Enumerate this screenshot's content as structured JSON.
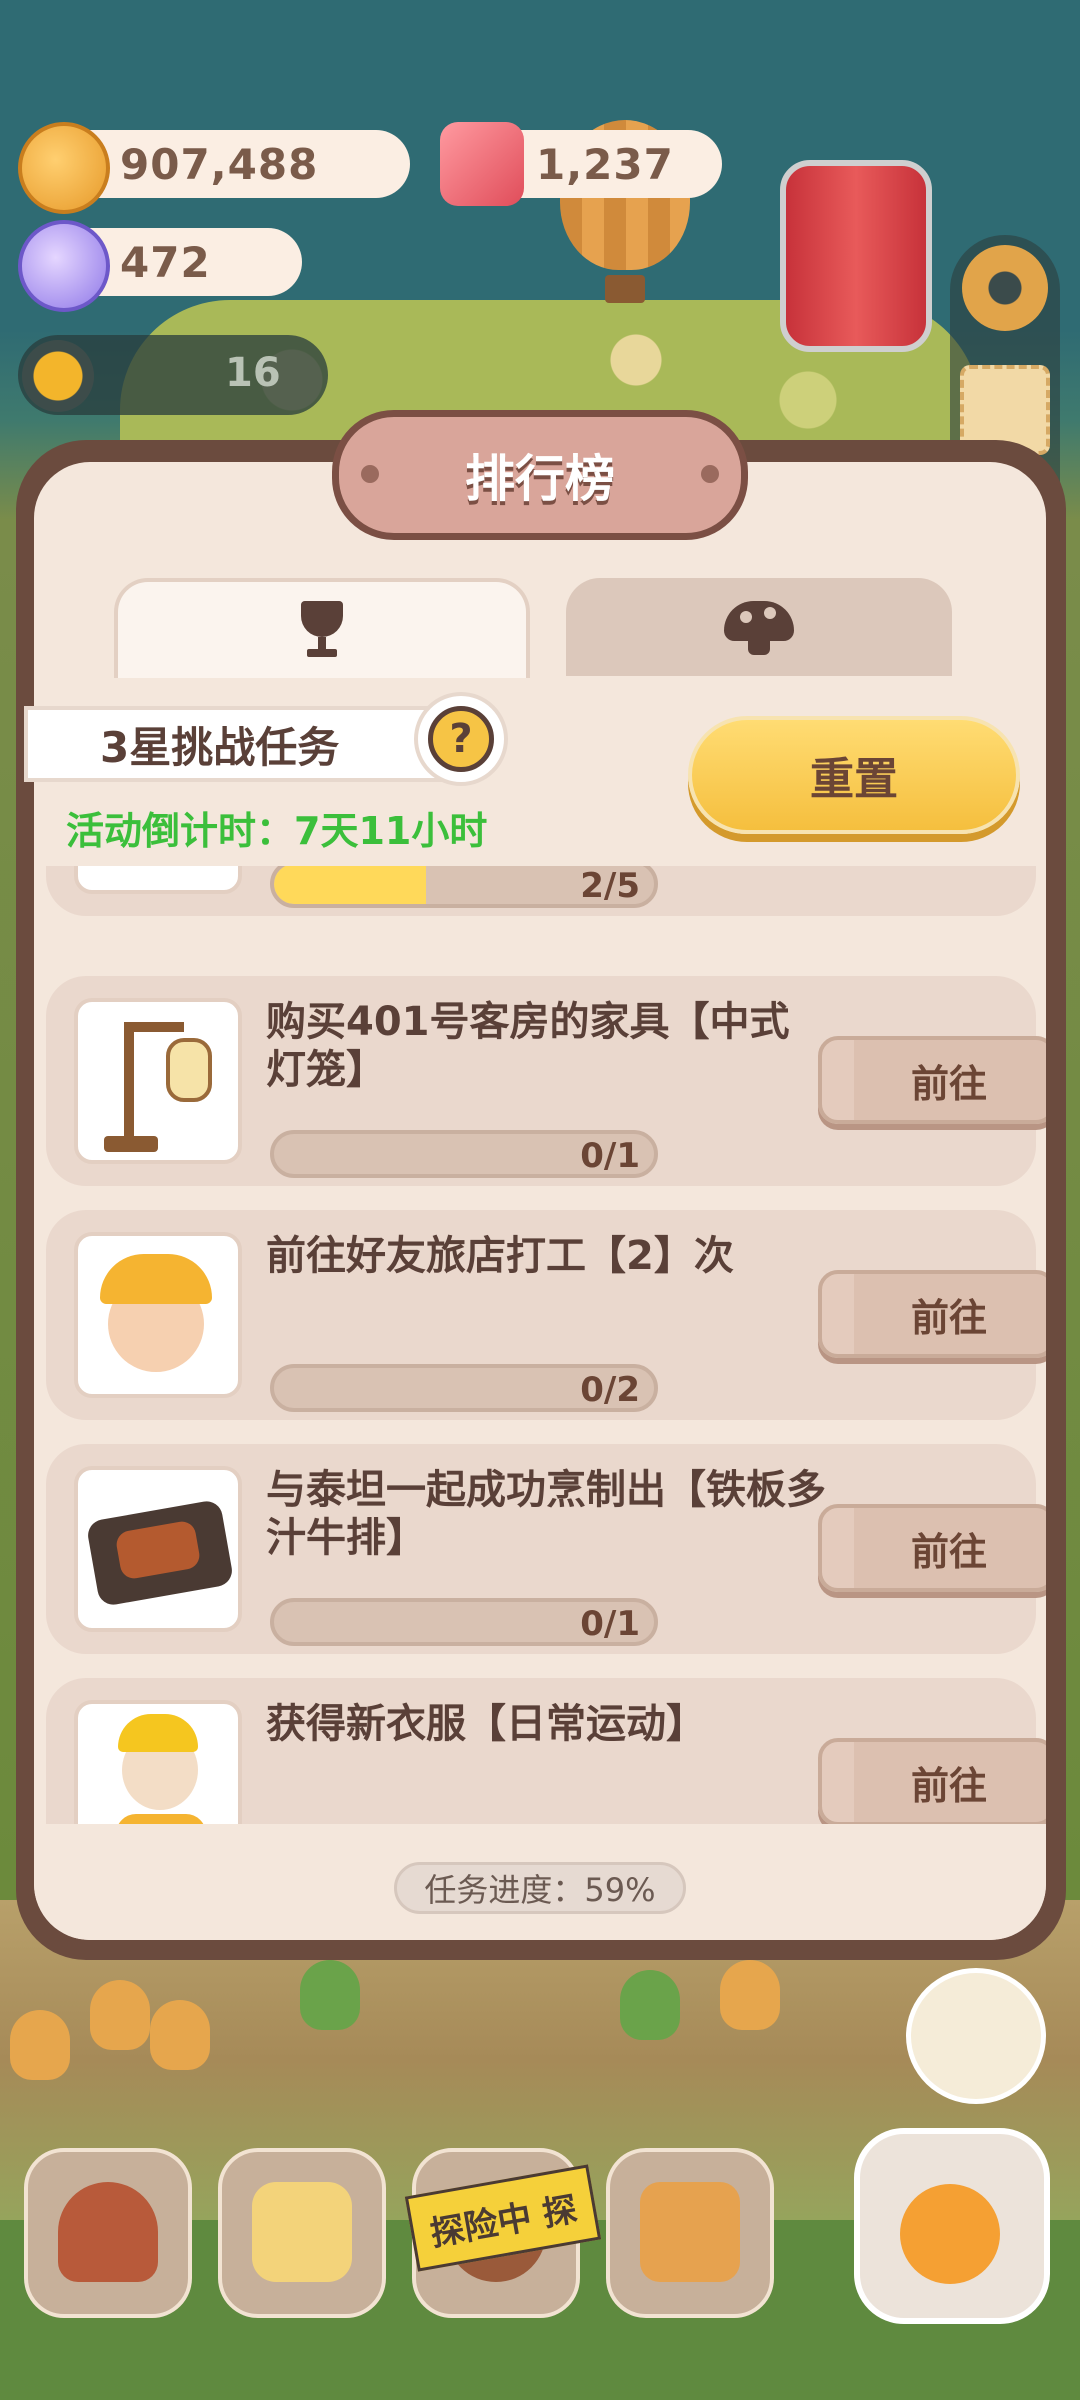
{
  "resources": {
    "cookies": "907,488",
    "gems": "1,237",
    "candy": "472"
  },
  "level": {
    "value": "16"
  },
  "panel": {
    "title": "排行榜",
    "tabs": [
      {
        "icon": "trophy-icon",
        "active": true
      },
      {
        "icon": "mushroom-icon",
        "active": false
      }
    ],
    "challenge_label": "3星挑战任务",
    "help_symbol": "?",
    "countdown": "活动倒计时：7天11小时",
    "reset_label": "重置",
    "tasks": [
      {
        "desc": "",
        "progress": "2/5",
        "fraction": 0.4,
        "go_label": ""
      },
      {
        "desc": "购买401号客房的家具【中式灯笼】",
        "progress": "0/1",
        "fraction": 0,
        "go_label": "前往"
      },
      {
        "desc": "前往好友旅店打工【2】次",
        "progress": "0/2",
        "fraction": 0,
        "go_label": "前往"
      },
      {
        "desc": "与泰坦一起成功烹制出【铁板多汁牛排】",
        "progress": "0/1",
        "fraction": 0,
        "go_label": "前往"
      },
      {
        "desc": "获得新衣服【日常运动】",
        "progress": "",
        "fraction": 0,
        "go_label": "前往"
      }
    ],
    "overall_progress": "任务进度：59%"
  },
  "bottom_nav": {
    "explore_label": "探险中 探"
  },
  "colors": {
    "accent_yellow": "#f5bf3e",
    "countdown_green": "#3bbf3b",
    "panel_border": "#6b4b3e",
    "text_brown": "#5a4038"
  }
}
